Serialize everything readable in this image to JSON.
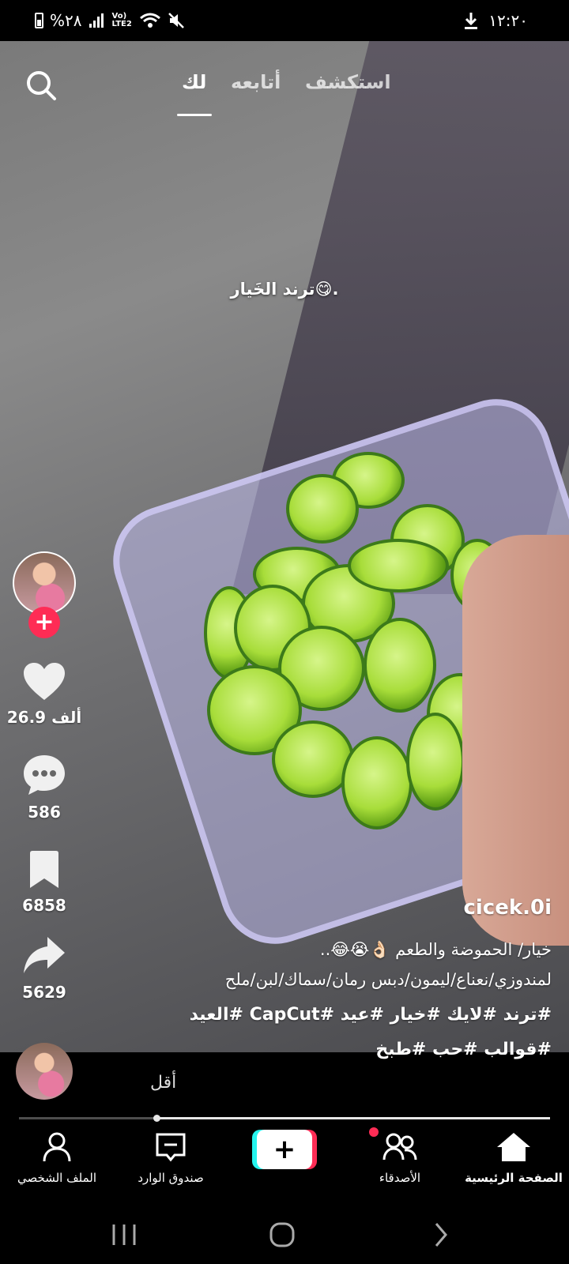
{
  "status_bar": {
    "battery_text": "%٢٨",
    "network_text": "Vo) LTE2",
    "time": "١٢:٢٠"
  },
  "top_nav": {
    "tabs": [
      {
        "label": "لك",
        "active": true
      },
      {
        "label": "أتابعه",
        "active": false
      },
      {
        "label": "استكشف",
        "active": false
      }
    ]
  },
  "video": {
    "overlay_text": "ترند الخَيار😋."
  },
  "side_actions": {
    "like_count": "26.9 ألف",
    "comment_count": "586",
    "save_count": "6858",
    "share_count": "5629"
  },
  "caption": {
    "username": "cicek.0i",
    "line1": "خيار/         الحموضة والطعم 👌🏻😭😂..",
    "line2": "لمندوزي/نعناع/ليمون/دبس رمان/سماك/لبن/ملح",
    "tags_line1": "#ترند #لايك #خيار #عيد #CapCut #العيد",
    "tags_line2": "#قوالب #حب #طبخ"
  },
  "less_label": "أقل",
  "playback": {
    "progress": 0.74
  },
  "bottom_nav": {
    "home": "الصفحة الرئيسية",
    "friends": "الأصدقاء",
    "inbox": "صندوق الوارد",
    "profile": "الملف الشخصي"
  },
  "colors": {
    "accent": "#fe2c55",
    "accent2": "#25f4ee"
  }
}
